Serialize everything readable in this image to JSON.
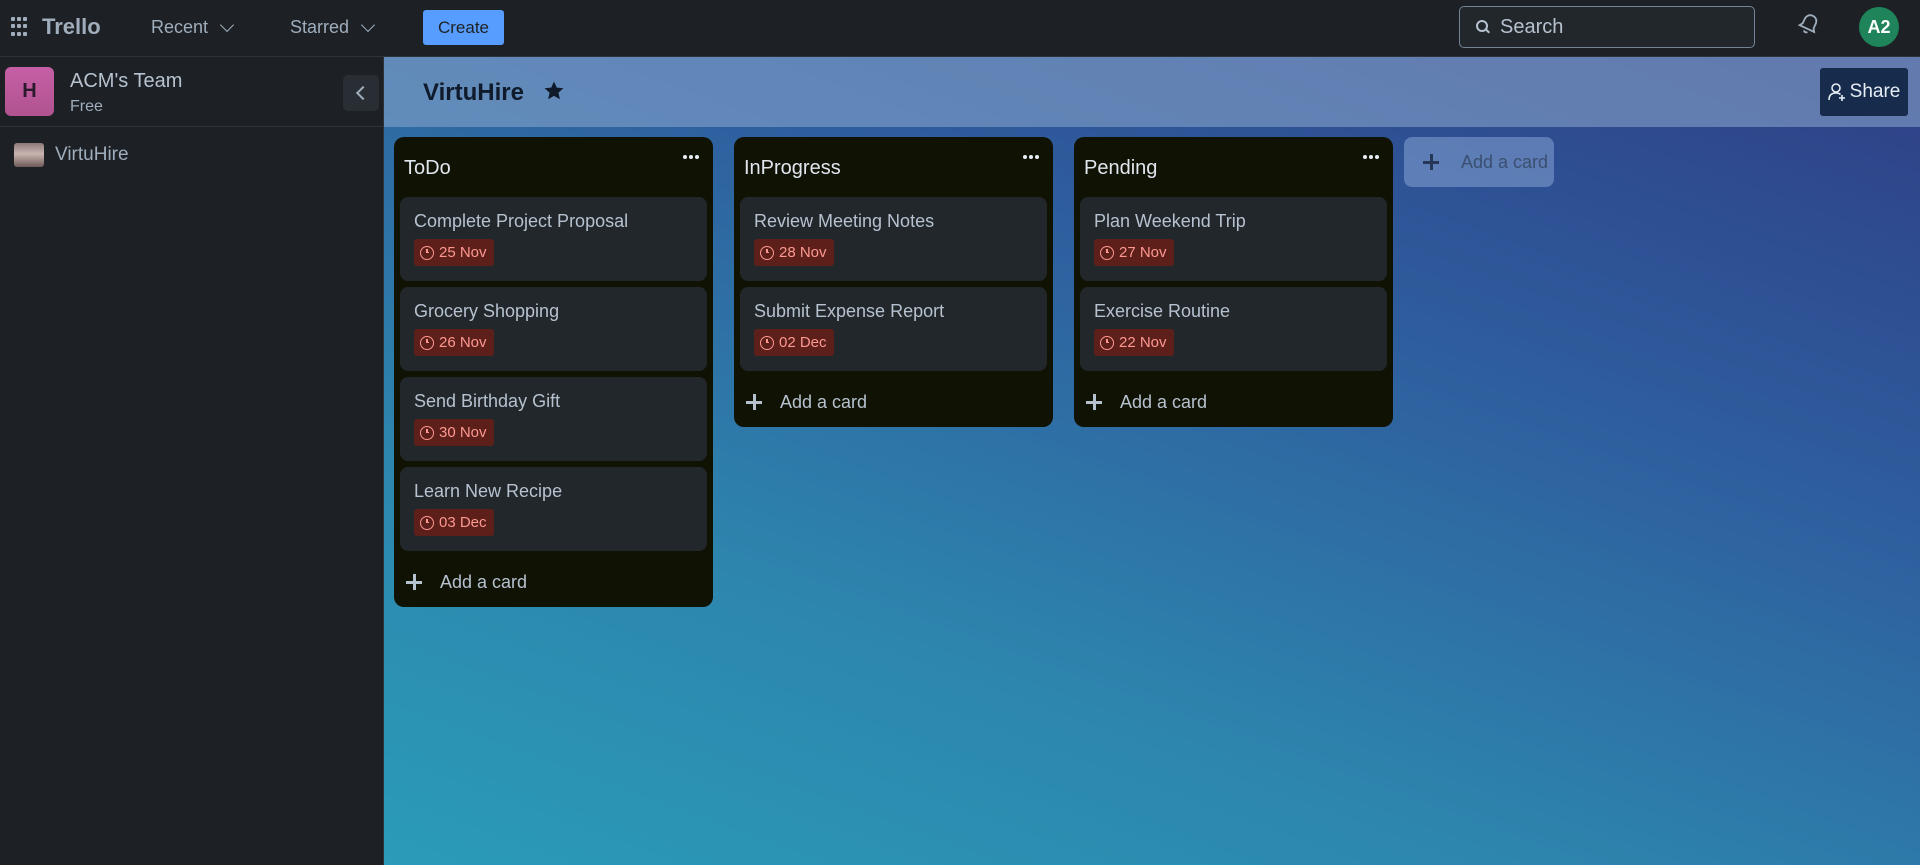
{
  "topnav": {
    "logo": "Trello",
    "recent_label": "Recent",
    "starred_label": "Starred",
    "create_label": "Create",
    "search_placeholder": "Search",
    "avatar_initials": "A2"
  },
  "sidebar": {
    "workspace_initial": "H",
    "workspace_name": "ACM's Team",
    "workspace_plan": "Free",
    "boards": [
      {
        "label": "VirtuHire"
      }
    ]
  },
  "board": {
    "title": "VirtuHire",
    "share_label": "Share",
    "add_list_label": "Add a card",
    "lists": [
      {
        "title": "ToDo",
        "cards": [
          {
            "title": "Complete Project Proposal",
            "due": "25 Nov"
          },
          {
            "title": "Grocery Shopping",
            "due": "26 Nov"
          },
          {
            "title": "Send Birthday Gift",
            "due": "30 Nov"
          },
          {
            "title": "Learn New Recipe",
            "due": "03 Dec"
          }
        ],
        "add_label": "Add a card"
      },
      {
        "title": "InProgress",
        "cards": [
          {
            "title": "Review Meeting Notes",
            "due": "28 Nov"
          },
          {
            "title": "Submit Expense Report",
            "due": "02 Dec"
          }
        ],
        "add_label": "Add a card"
      },
      {
        "title": "Pending",
        "cards": [
          {
            "title": "Plan Weekend Trip",
            "due": "27 Nov"
          },
          {
            "title": "Exercise Routine",
            "due": "22 Nov"
          }
        ],
        "add_label": "Add a card"
      }
    ]
  },
  "colors": {
    "accent": "#579dff",
    "due_badge_bg": "#5d1f1a",
    "due_badge_text": "#fd9891",
    "avatar_bg": "#1f845a",
    "workspace_logo": "#c65fa6"
  }
}
